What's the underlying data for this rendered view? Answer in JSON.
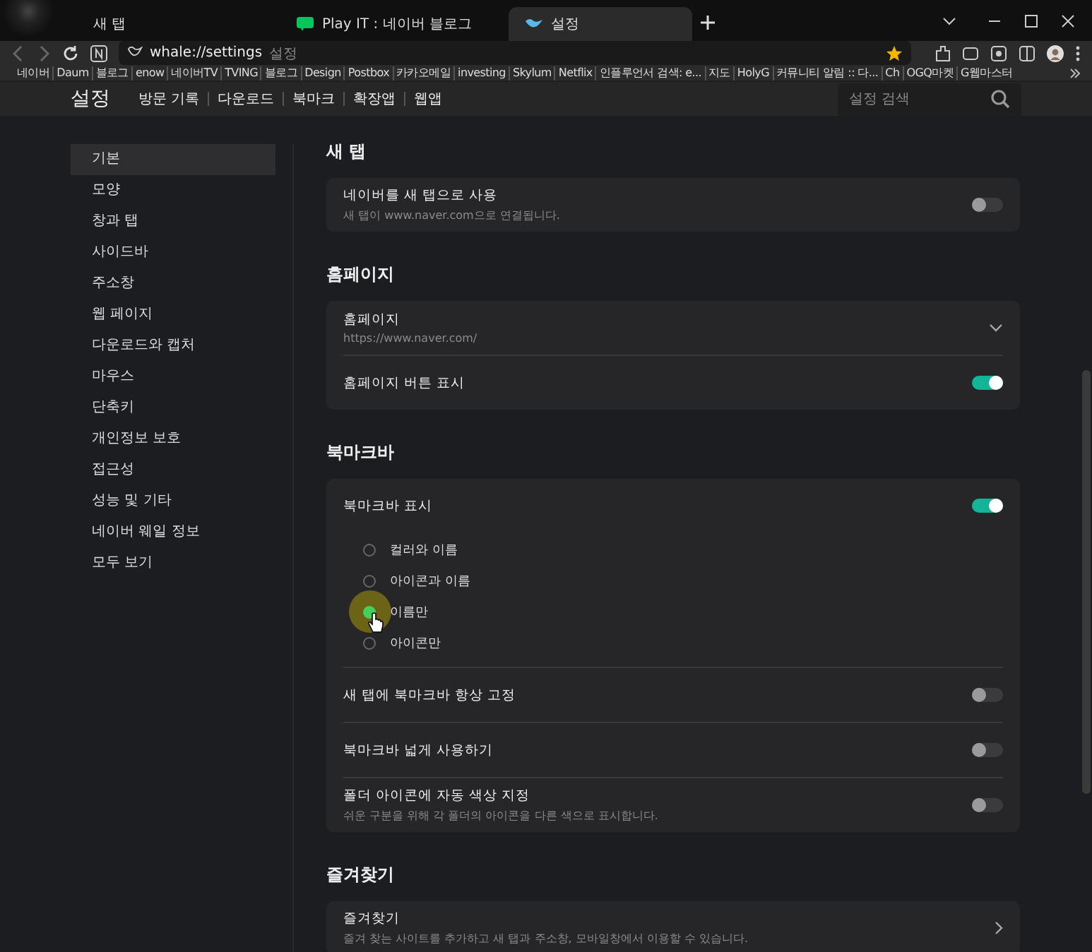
{
  "tabs": [
    {
      "title": "새 탭",
      "selected": false
    },
    {
      "title": "Play IT : 네이버 블로그",
      "selected": false
    },
    {
      "title": "설정",
      "selected": true
    }
  ],
  "address": {
    "url": "whale://settings",
    "label": "설정"
  },
  "bookmarks": [
    "네이버",
    "Daum",
    "블로그",
    "enow",
    "네이버TV",
    "TVING",
    "블로그",
    "Design",
    "Postbox",
    "카카오메일",
    "investing",
    "Skylum",
    "Netflix",
    "인플루언서 검색: e...",
    "지도",
    "HolyG",
    "커뮤니티 알림 :: 다...",
    "Ch",
    "OGQ마켓",
    "G웹마스터"
  ],
  "header": {
    "title": "설정",
    "links": [
      "방문 기록",
      "다운로드",
      "북마크",
      "확장앱",
      "웹앱"
    ],
    "search_placeholder": "설정 검색"
  },
  "sidebar": [
    {
      "label": "기본",
      "selected": true
    },
    {
      "label": "모양",
      "selected": false
    },
    {
      "label": "창과 탭",
      "selected": false
    },
    {
      "label": "사이드바",
      "selected": false
    },
    {
      "label": "주소창",
      "selected": false
    },
    {
      "label": "웹 페이지",
      "selected": false
    },
    {
      "label": "다운로드와 캡처",
      "selected": false
    },
    {
      "label": "마우스",
      "selected": false
    },
    {
      "label": "단축키",
      "selected": false
    },
    {
      "label": "개인정보 보호",
      "selected": false
    },
    {
      "label": "접근성",
      "selected": false
    },
    {
      "label": "성능 및 기타",
      "selected": false
    },
    {
      "label": "네이버 웨일 정보",
      "selected": false
    },
    {
      "label": "모두 보기",
      "selected": false
    }
  ],
  "sections": [
    {
      "title": "새 탭",
      "rows": [
        {
          "kind": "toggle",
          "label": "네이버를 새 탭으로 사용",
          "description": "새 탭이 www.naver.com으로 연결됩니다.",
          "on": false
        }
      ]
    },
    {
      "title": "홈페이지",
      "rows": [
        {
          "kind": "select",
          "label": "홈페이지",
          "description": "https://www.naver.com/"
        },
        {
          "kind": "toggle",
          "label": "홈페이지 버튼 표시",
          "on": true
        }
      ]
    },
    {
      "title": "북마크바",
      "rows": [
        {
          "kind": "toggle",
          "label": "북마크바 표시",
          "on": true
        },
        {
          "kind": "radio",
          "options": [
            {
              "label": "컬러와 이름",
              "selected": false
            },
            {
              "label": "아이콘과 이름",
              "selected": false
            },
            {
              "label": "이름만",
              "selected": true
            },
            {
              "label": "아이콘만",
              "selected": false
            }
          ]
        },
        {
          "kind": "toggle",
          "label": "새 탭에 북마크바 항상 고정",
          "on": false
        },
        {
          "kind": "toggle",
          "label": "북마크바 넓게 사용하기",
          "on": false
        },
        {
          "kind": "toggle",
          "label": "폴더 아이콘에 자동 색상 지정",
          "description": "쉬운 구분을 위해 각 폴더의 아이콘을 다른 색으로 표시합니다.",
          "on": false
        }
      ]
    },
    {
      "title": "즐겨찾기",
      "rows": [
        {
          "kind": "link",
          "label": "즐겨찾기",
          "description": "즐겨 찾는 사이트를 추가하고 새 탭과 주소창, 모바일창에서 이용할 수 있습니다."
        }
      ]
    }
  ]
}
